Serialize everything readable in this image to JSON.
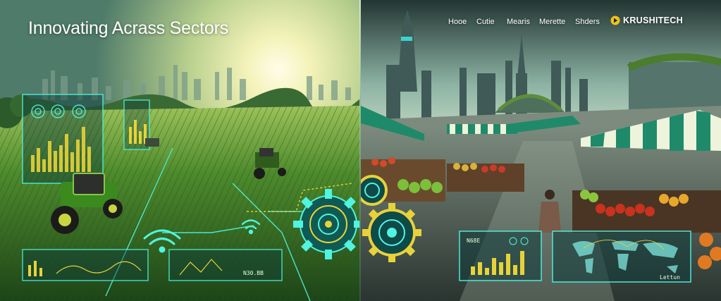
{
  "hero": {
    "headline": "Innovating Acrass Sectors"
  },
  "nav": {
    "items": [
      {
        "label": "Hooe"
      },
      {
        "label": "Cutie"
      },
      {
        "label": "Mearis"
      },
      {
        "label": "Merette"
      },
      {
        "label": "Shders"
      }
    ]
  },
  "brand": {
    "name": "KRUSHITECH",
    "icon": "play-triangle-icon",
    "icon_color": "#f2c21b"
  },
  "hud": {
    "left_panel_label": "N30.BB",
    "right_panel_label": "N68E",
    "map_caption": "Lettun"
  },
  "colors": {
    "hud_cyan": "#4ff5e0",
    "hud_yellow": "#e8d23a",
    "awning_green": "#1f8a6a",
    "awning_cream": "#eef3dc"
  }
}
